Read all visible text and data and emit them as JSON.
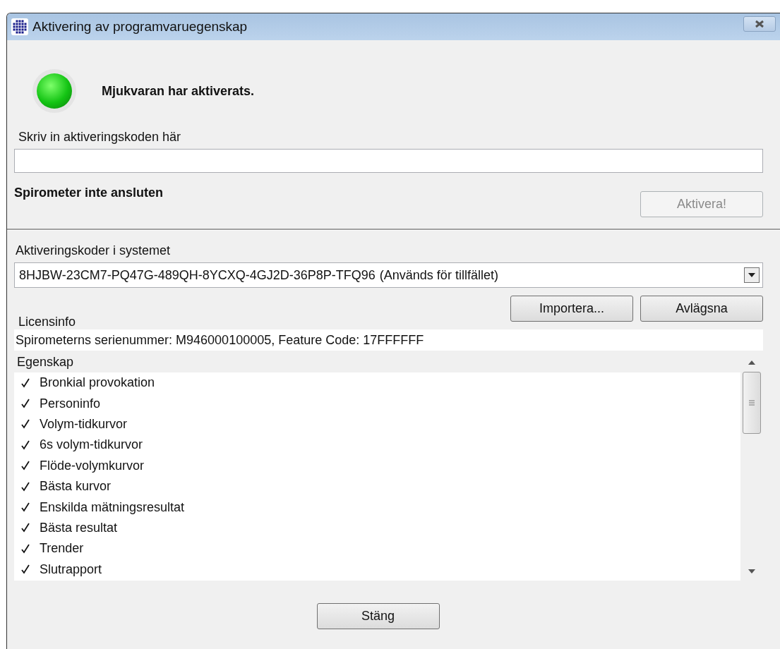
{
  "window": {
    "title": "Aktivering av programvaruegenskap"
  },
  "status": {
    "activated": true,
    "message": "Mjukvaran har aktiverats."
  },
  "code_field": {
    "label": "Skriv in aktiveringskoden här"
  },
  "connection": "Spirometer inte ansluten",
  "activate_button": {
    "label": "Aktivera!",
    "disabled": true
  },
  "codes": {
    "label": "Aktiveringskoder i systemet",
    "value": "8HJBW-23CM7-PQ47G-489QH-8YCXQ-4GJ2D-36P8P-TFQ96",
    "note": "(Används för tillfället)"
  },
  "code_buttons": [
    "Importera...",
    "Avlägsna"
  ],
  "license": {
    "label": "Licensinfo",
    "info": "Spirometerns serienummer: M946000100005, Feature Code: 17FFFFFF"
  },
  "features": {
    "column": "Egenskap",
    "items": [
      {
        "name": "Bronkial provokation",
        "checked": true
      },
      {
        "name": "Personinfo",
        "checked": true
      },
      {
        "name": "Volym-tidkurvor",
        "checked": true
      },
      {
        "name": "6s volym-tidkurvor",
        "checked": true
      },
      {
        "name": "Flöde-volymkurvor",
        "checked": true
      },
      {
        "name": "Bästa kurvor",
        "checked": true
      },
      {
        "name": "Enskilda mätningsresultat",
        "checked": true
      },
      {
        "name": "Bästa resultat",
        "checked": true
      },
      {
        "name": "Trender",
        "checked": true
      },
      {
        "name": "Slutrapport",
        "checked": true
      }
    ]
  },
  "close_button": "Stäng"
}
